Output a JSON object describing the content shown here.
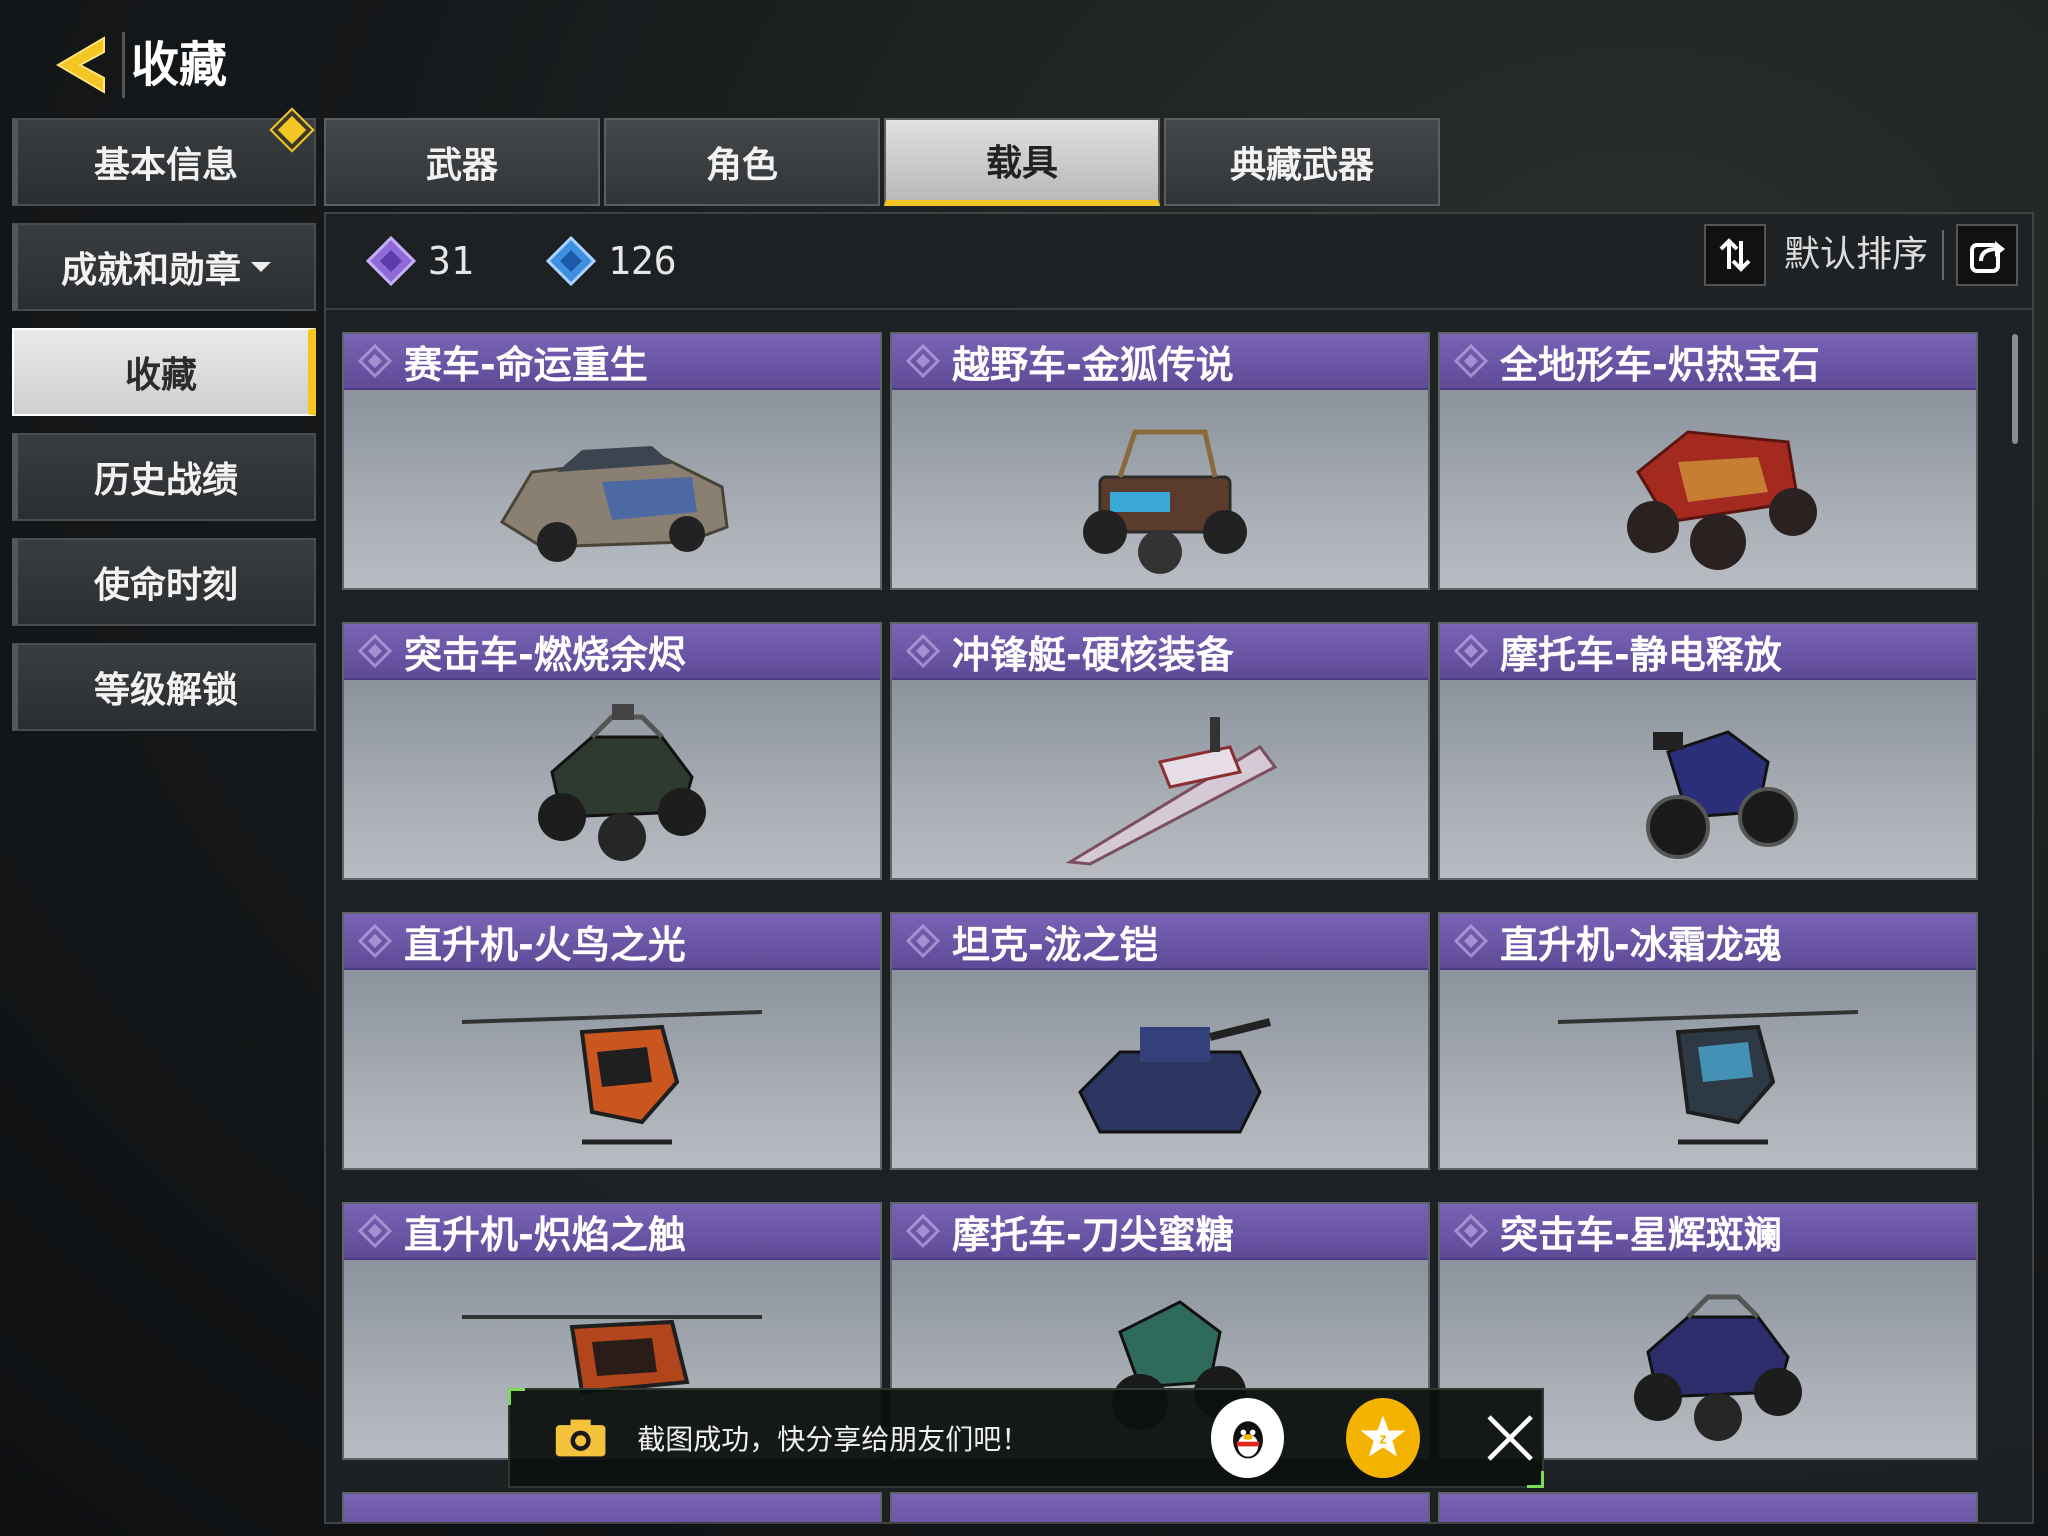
{
  "header": {
    "title": "收藏"
  },
  "sidebar": {
    "items": [
      {
        "label": "基本信息",
        "active": false,
        "badge": true
      },
      {
        "label": "成就和勋章",
        "active": false,
        "dropdown": true
      },
      {
        "label": "收藏",
        "active": true
      },
      {
        "label": "历史战绩",
        "active": false
      },
      {
        "label": "使命时刻",
        "active": false
      },
      {
        "label": "等级解锁",
        "active": false
      }
    ]
  },
  "tabs": [
    {
      "label": "武器",
      "active": false
    },
    {
      "label": "角色",
      "active": false
    },
    {
      "label": "载具",
      "active": true
    },
    {
      "label": "典藏武器",
      "active": false
    }
  ],
  "stats": {
    "purple_count": "31",
    "blue_count": "126"
  },
  "sort": {
    "label": "默认排序"
  },
  "cards": [
    {
      "name": "赛车-命运重生",
      "icon": "rally-car"
    },
    {
      "name": "越野车-金狐传说",
      "icon": "buggy"
    },
    {
      "name": "全地形车-炽热宝石",
      "icon": "atv"
    },
    {
      "name": "突击车-燃烧余烬",
      "icon": "assault-buggy"
    },
    {
      "name": "冲锋艇-硬核装备",
      "icon": "speedboat"
    },
    {
      "name": "摩托车-静电释放",
      "icon": "motorcycle"
    },
    {
      "name": "直升机-火鸟之光",
      "icon": "helicopter"
    },
    {
      "name": "坦克-泷之铠",
      "icon": "tank"
    },
    {
      "name": "直升机-冰霜龙魂",
      "icon": "helicopter"
    },
    {
      "name": "直升机-炽焰之触",
      "icon": "helicopter"
    },
    {
      "name": "摩托车-刀尖蜜糖",
      "icon": "motorcycle"
    },
    {
      "name": "突击车-星辉斑斓",
      "icon": "assault-buggy"
    }
  ],
  "toast": {
    "text": "截图成功，快分享给朋友们吧！"
  },
  "colors": {
    "accent": "#f3c623",
    "card_header": "#6a55a8",
    "toast_border": "#7ed957"
  }
}
